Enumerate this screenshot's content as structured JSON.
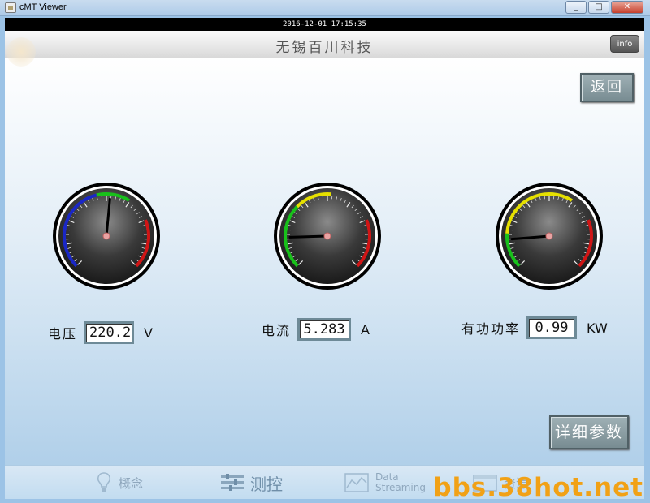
{
  "window": {
    "title": "cMT Viewer",
    "buttons": [
      "_",
      "□",
      "✕"
    ]
  },
  "clock": "2016-12-01  17:15:35",
  "header": {
    "title": "无锡百川科技",
    "info_label": "info"
  },
  "back_label": "返回",
  "detail_label": "详细参数",
  "gauges": [
    {
      "id": "voltage",
      "label": "电压",
      "value": "220.2",
      "unit": "V",
      "needle_fraction": 0.52
    },
    {
      "id": "current",
      "label": "电流",
      "value": "5.283",
      "unit": "A",
      "needle_fraction": 0.16
    },
    {
      "id": "power",
      "label": "有功功率",
      "value": "0.99",
      "unit": "KW",
      "needle_fraction": 0.15
    }
  ],
  "nav": [
    {
      "label": "概念",
      "icon": "lightbulb-icon"
    },
    {
      "label": "测控",
      "icon": "sliders-icon",
      "active": true
    },
    {
      "label_line1": "Data",
      "label_line2": "Streaming",
      "icon": "chart-icon"
    },
    {
      "label": "资源",
      "icon": "folder-icon"
    }
  ],
  "watermark": "bbs.38hot.net",
  "colors": {
    "accent_green": "#18c11a",
    "accent_red": "#d11515",
    "accent_yellow": "#e6e000",
    "accent_blue": "#1a27c7"
  }
}
